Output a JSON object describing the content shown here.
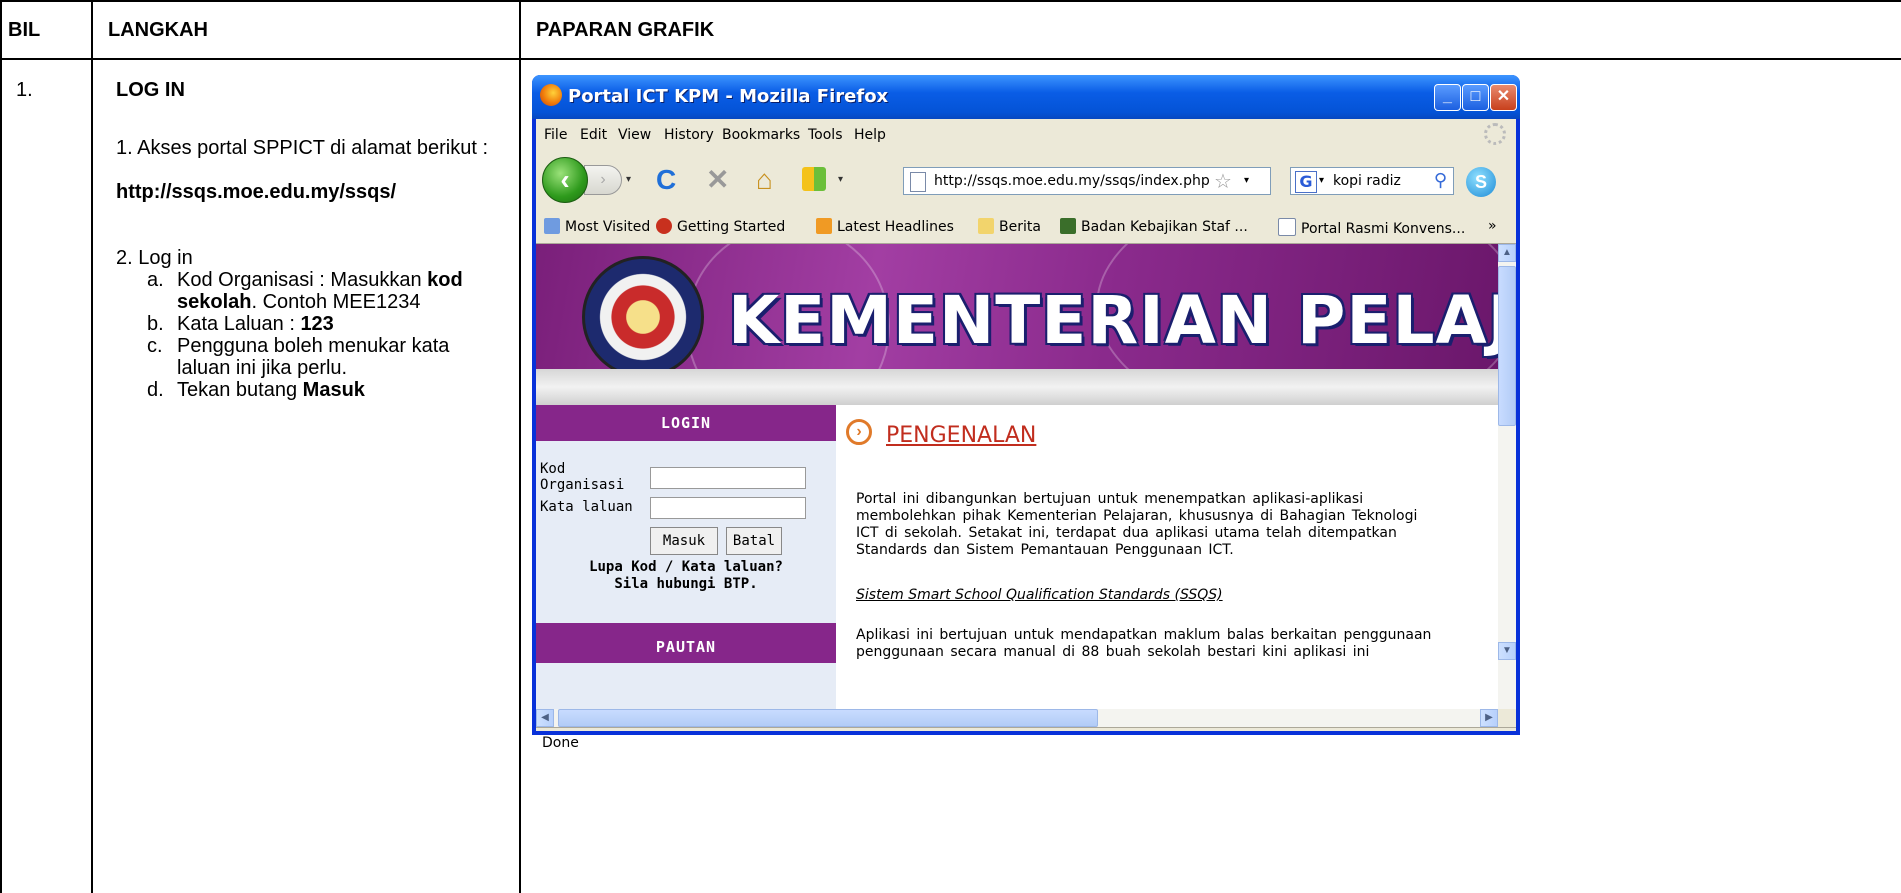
{
  "table": {
    "headers": {
      "bil": "BIL",
      "langkah": "LANGKAH",
      "paparan": "PAPARAN GRAFIK"
    },
    "row": {
      "number": "1.",
      "heading": "LOG IN",
      "step1_text": "1.  Akses portal SPPICT di alamat berikut :",
      "step1_url": "http://ssqs.moe.edu.my/ssqs/",
      "step2_text": "2.  Log in",
      "substeps": {
        "a_marker": "a.",
        "a_text": "Kod Organisasi : Masukkan ",
        "a_bold": "kod sekolah",
        "a_rest": ". Contoh MEE1234",
        "b_marker": "b.",
        "b_text": "Kata Laluan : ",
        "b_bold": "123",
        "c_marker": "c.",
        "c_text": "Pengguna boleh menukar kata laluan ini jika perlu.",
        "d_marker": "d.",
        "d_text": "Tekan butang ",
        "d_bold": "Masuk"
      }
    }
  },
  "browser": {
    "title": "Portal ICT KPM - Mozilla Firefox",
    "caption_buttons": {
      "minimize": "_",
      "maximize": "□",
      "close": "✕"
    },
    "menu": [
      "File",
      "Edit",
      "View",
      "History",
      "Bookmarks",
      "Tools",
      "Help"
    ],
    "nav": {
      "back": "‹",
      "forward": "›",
      "reload": "C",
      "stop": "✕",
      "home": "⌂",
      "dropdown": "▾"
    },
    "url": "http://ssqs.moe.edu.my/ssqs/index.php",
    "search_query": "kopi radiz",
    "search_engine_icon": "G",
    "bookmarks": [
      "Most Visited",
      "Getting Started",
      "Latest Headlines",
      "Berita",
      "Badan Kebajikan Staf ...",
      "Portal Rasmi Konvens...",
      "»"
    ],
    "status": "Done",
    "icon_colors": {
      "titlebar": "#0a5de6",
      "back_button": "#2e9a1c",
      "banner": "#a23ea3",
      "section_heading": "#c12d1e"
    }
  },
  "page": {
    "banner_title": "KEMENTERIAN PELAJARAN",
    "login": {
      "heading": "LOGIN",
      "org_label": "Kod Organisasi",
      "password_label": "Kata laluan",
      "submit": "Masuk",
      "cancel": "Batal",
      "help_line1": "Lupa Kod / Kata laluan?",
      "help_line2": "Sila hubungi BTP."
    },
    "links_heading": "PAUTAN",
    "section_title": "PENGENALAN",
    "intro_lines": [
      "Portal ini dibangunkan bertujuan untuk menempatkan aplikasi-aplikasi",
      "membolehkan pihak Kementerian Pelajaran, khususnya di Bahagian Teknologi",
      "ICT di sekolah.  Setakat ini, terdapat dua aplikasi utama telah ditempatkan",
      "Standards dan Sistem Pemantauan Penggunaan ICT."
    ],
    "ssqs_link": "Sistem Smart School Qualification Standards (SSQS)",
    "ssqs_lines": [
      "Aplikasi ini bertujuan untuk mendapatkan maklum balas berkaitan penggunaan",
      "penggunaan secara manual di 88 buah sekolah bestari kini aplikasi ini"
    ]
  }
}
